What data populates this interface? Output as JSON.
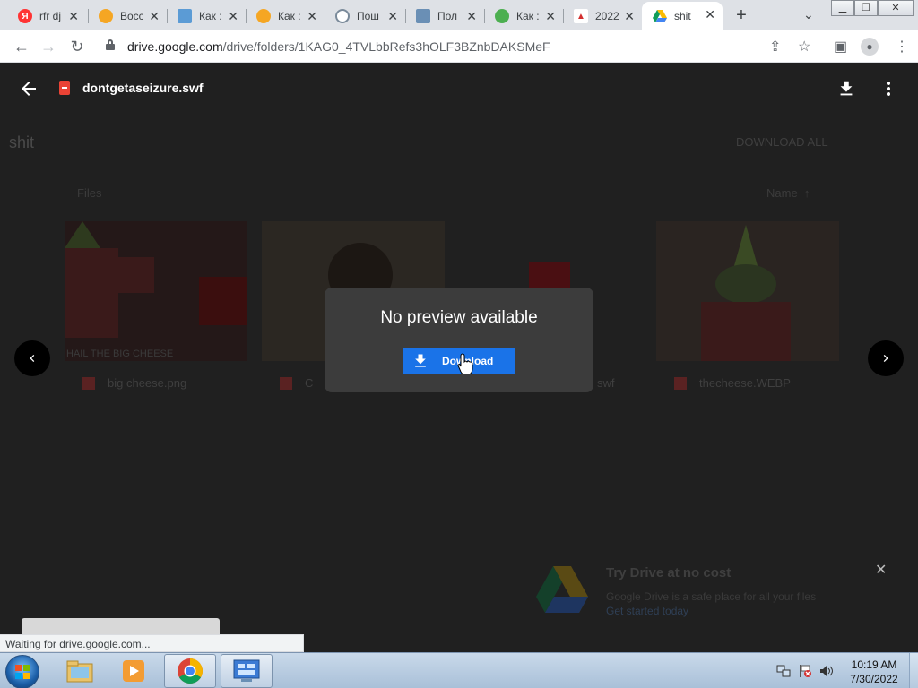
{
  "browser": {
    "tabs": [
      {
        "title": "rfr dj",
        "favicon": "yandex-icon",
        "color": "#f33"
      },
      {
        "title": "Восс",
        "favicon": "orange-globe-icon",
        "color": "#f5a623"
      },
      {
        "title": "Как :",
        "favicon": "monitor-icon",
        "color": "#5b9bd5"
      },
      {
        "title": "Как :",
        "favicon": "orange-globe-icon",
        "color": "#f5a623"
      },
      {
        "title": "Пош",
        "favicon": "gear-icon",
        "color": "#7a8a9a"
      },
      {
        "title": "Пол",
        "favicon": "computer-icon",
        "color": "#6a8fb5"
      },
      {
        "title": "Как :",
        "favicon": "green-circle-icon",
        "color": "#4caf50"
      },
      {
        "title": "2022",
        "favicon": "adobe-icon",
        "color": "#d32f2f"
      },
      {
        "title": "shit",
        "favicon": "google-drive-icon",
        "color": "#1a73e8",
        "active": true
      }
    ],
    "url_domain": "drive.google.com",
    "url_path": "/drive/folders/1KAG0_4TVLbbRefs3hOLF3BZnbDAKSMeF"
  },
  "viewer": {
    "file_name": "dontgetaseizure.swf",
    "no_preview_text": "No preview available",
    "download_label": "Download"
  },
  "drive": {
    "folder_title": "shit",
    "download_all": "DOWNLOAD ALL",
    "files_label": "Files",
    "sort_label": "Name",
    "files": [
      {
        "name": "big cheese.png"
      },
      {
        "name": "C"
      },
      {
        "name": "swf"
      },
      {
        "name": "thecheese.WEBP"
      }
    ],
    "thumb_caption": "HAIL THE BIG CHEESE",
    "promo": {
      "title": "Try Drive at no cost",
      "text": "Google Drive is a safe place for all your files",
      "link": "Get started today"
    }
  },
  "status_text": "Waiting for drive.google.com...",
  "taskbar": {
    "time": "10:19 AM",
    "date": "7/30/2022"
  }
}
